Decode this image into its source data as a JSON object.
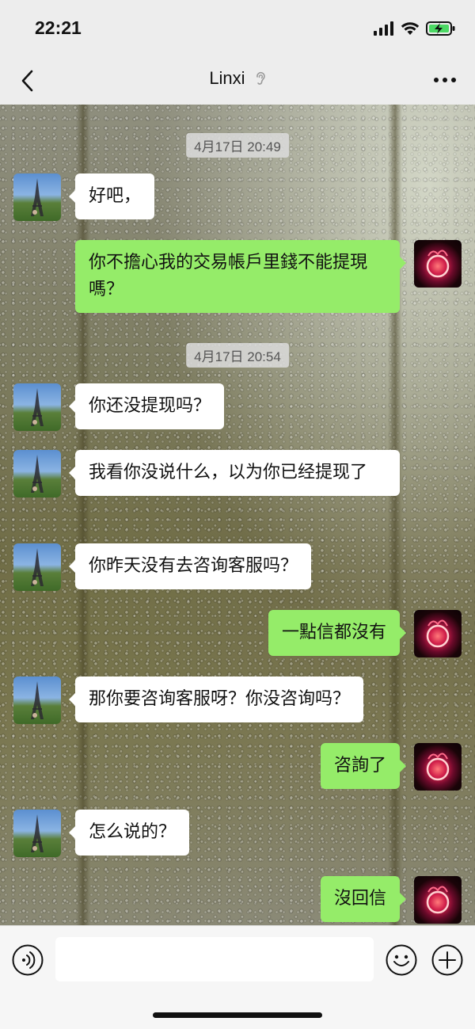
{
  "status_bar": {
    "time": "22:21"
  },
  "nav": {
    "title": "Linxi"
  },
  "timestamps": [
    "4月17日 20:49",
    "4月17日 20:54"
  ],
  "messages": [
    {
      "side": "in",
      "text": "好吧，"
    },
    {
      "side": "out",
      "text": "你不擔心我的交易帳戶里錢不能提現嗎？"
    },
    {
      "side": "in",
      "text": "你还没提现吗？"
    },
    {
      "side": "in",
      "text": "我看你没说什么，以为你已经提现了"
    },
    {
      "side": "in",
      "text": "你昨天没有去咨询客服吗？"
    },
    {
      "side": "out",
      "text": "一點信都沒有"
    },
    {
      "side": "in",
      "text": "那你要咨询客服呀？你没咨询吗？"
    },
    {
      "side": "out",
      "text": "咨詢了"
    },
    {
      "side": "in",
      "text": "怎么说的？"
    },
    {
      "side": "out",
      "text": "沒回信"
    }
  ],
  "colors": {
    "incoming_bubble": "#ffffff",
    "outgoing_bubble": "#95ec69",
    "bar_background": "#ededed"
  }
}
